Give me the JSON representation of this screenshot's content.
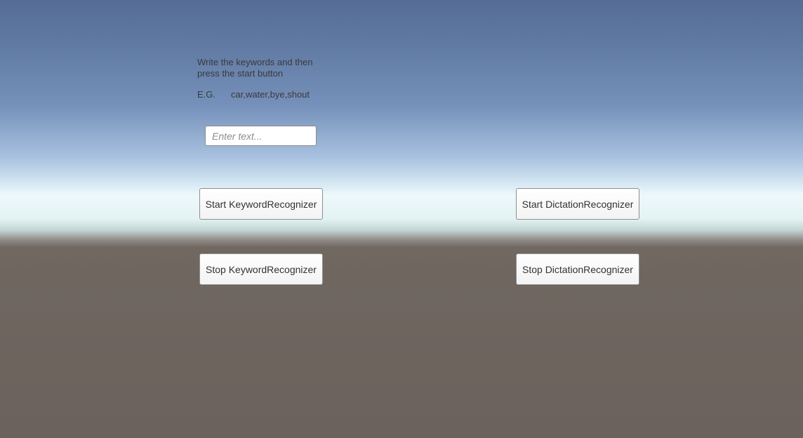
{
  "instructions": {
    "line1": "Write the keywords and then",
    "line2": "press the start button"
  },
  "example": {
    "label": "E.G.",
    "value": "car,water,bye,shout"
  },
  "keyword_input": {
    "value": "",
    "placeholder": "Enter text..."
  },
  "buttons": {
    "start_keyword": "Start KeywordRecognizer",
    "stop_keyword": "Stop KeywordRecognizer",
    "start_dictation": "Start DictationRecognizer",
    "stop_dictation": "Stop DictationRecognizer"
  },
  "colors": {
    "sky_top": "#566c96",
    "horizon": "#eef8fb",
    "ground": "#6c625d",
    "button_bg": "#f5f5f5",
    "text": "#3a3a3a"
  }
}
